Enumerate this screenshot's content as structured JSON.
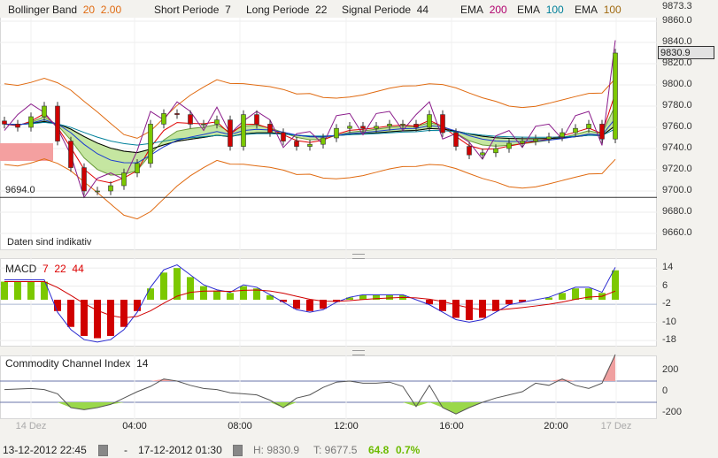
{
  "header": {
    "bb_label": "Bollinger Band",
    "bb_period": "20",
    "bb_dev": "2.00",
    "short_label": "Short Periode",
    "short_val": "7",
    "long_label": "Long Periode",
    "long_val": "22",
    "signal_label": "Signal Periode",
    "signal_val": "44",
    "ema1_label": "EMA",
    "ema1_val": "200",
    "ema2_label": "EMA",
    "ema2_val": "100",
    "ema3_label": "EMA",
    "ema3_val": "100"
  },
  "colors": {
    "orange": "#e06a10",
    "ema200": "#b0006e",
    "ema100": "#00809a",
    "ema100b": "#a06a10",
    "up": "#7cc800",
    "down": "#d00000"
  },
  "main": {
    "note": "Daten sind indikativ",
    "ref_line_label": "9694.0",
    "last_price": "9830.9",
    "price_ticks": [
      "9873.3",
      "9860.0",
      "9840.0",
      "9820.0",
      "9800.0",
      "9780.0",
      "9760.0",
      "9740.0",
      "9720.0",
      "9700.0",
      "9680.0",
      "9660.0"
    ]
  },
  "macd": {
    "label": "MACD",
    "p1": "7",
    "p2": "22",
    "p3": "44",
    "ticks": [
      "14",
      "6",
      "-2",
      "-10",
      "-18"
    ]
  },
  "cci": {
    "label": "Commodity Channel Index",
    "period": "14",
    "ticks": [
      "200",
      "0",
      "-200"
    ]
  },
  "time_ticks": [
    "14 Dez",
    "04:00",
    "08:00",
    "12:00",
    "16:00",
    "20:00",
    "17 Dez"
  ],
  "footer": {
    "from": "13-12-2012 22:45",
    "sep": "-",
    "to": "17-12-2012 01:30",
    "high": "H: 9830.9",
    "low": "T: 9677.5",
    "change": "64.8",
    "change_pct": "0.7%"
  },
  "chart_data": {
    "type": "candlestick",
    "ylim": [
      9650,
      9873.3
    ],
    "close": [
      9763,
      9760,
      9770,
      9780,
      9747,
      9722,
      9700,
      9700,
      9705,
      9717,
      9726,
      9763,
      9773,
      9772,
      9763,
      9763,
      9767,
      9742,
      9772,
      9763,
      9755,
      9747,
      9742,
      9744,
      9750,
      9759,
      9761,
      9759,
      9761,
      9763,
      9763,
      9760,
      9772,
      9755,
      9742,
      9734,
      9736,
      9740,
      9745,
      9747,
      9749,
      9751,
      9755,
      9759,
      9763,
      9749,
      9830
    ],
    "macd_hist": [
      8,
      8,
      8,
      8,
      -5,
      -12,
      -16,
      -17,
      -16,
      -12,
      -5,
      5,
      12,
      14,
      10,
      6,
      4,
      3,
      6,
      5,
      2,
      -1,
      -4,
      -5,
      -4,
      -1,
      1,
      2,
      2,
      2,
      2,
      0,
      -2,
      -5,
      -8,
      -9,
      -8,
      -5,
      -2,
      -1,
      0,
      1,
      3,
      5,
      5,
      3,
      13
    ],
    "cci": [
      20,
      25,
      30,
      20,
      -20,
      -150,
      -170,
      -150,
      -120,
      -60,
      0,
      50,
      120,
      100,
      60,
      30,
      20,
      -10,
      -20,
      -30,
      -80,
      -150,
      -60,
      -30,
      40,
      90,
      100,
      80,
      80,
      90,
      50,
      -140,
      60,
      -150,
      -210,
      -150,
      -100,
      -60,
      -30,
      0,
      80,
      60,
      120,
      60,
      30,
      80,
      350
    ]
  }
}
